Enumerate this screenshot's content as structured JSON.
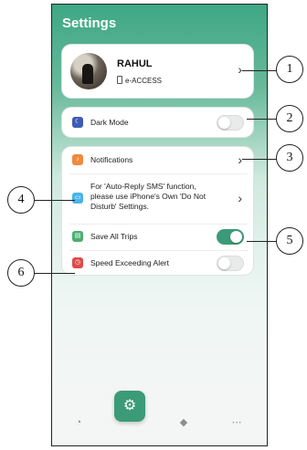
{
  "header": {
    "title": "Settings"
  },
  "profile": {
    "name": "RAHUL",
    "subtitle": "e-ACCESS",
    "chevron": "›"
  },
  "dark_mode": {
    "label": "Dark Mode",
    "icon": "moon-icon",
    "icon_color": "#3f5bb5",
    "enabled": false
  },
  "settings": {
    "notifications": {
      "label": "Notifications",
      "icon": "bell-icon",
      "icon_color": "#f08a3c",
      "chevron": "›"
    },
    "auto_reply": {
      "label_1": "For 'Auto-Reply SMS' function,",
      "label_2": "please use iPhone's Own 'Do Not",
      "label_3": "Disturb' Settings.",
      "icon": "message-icon",
      "icon_color": "#4ab3e6",
      "chevron": "›"
    },
    "save_trips": {
      "label": "Save All Trips",
      "icon": "trash-icon",
      "icon_color": "#4cae70",
      "enabled": true
    },
    "speed_alert": {
      "label": "Speed Exceeding Alert",
      "icon": "speed-alert-icon",
      "icon_color": "#e04a4a",
      "enabled": false
    }
  },
  "tabbar": {
    "tabs": [
      {
        "icon": "speedometer-icon",
        "glyph": "◔"
      },
      {
        "icon": "settings-gear-icon",
        "glyph": "⚙"
      },
      {
        "icon": "navigation-icon",
        "glyph": "◆"
      },
      {
        "icon": "more-icon",
        "glyph": "⋯"
      }
    ]
  },
  "callouts": [
    "1",
    "2",
    "3",
    "4",
    "5",
    "6"
  ],
  "colors": {
    "accent": "#3b9b78",
    "header_green": "#3ea785"
  }
}
